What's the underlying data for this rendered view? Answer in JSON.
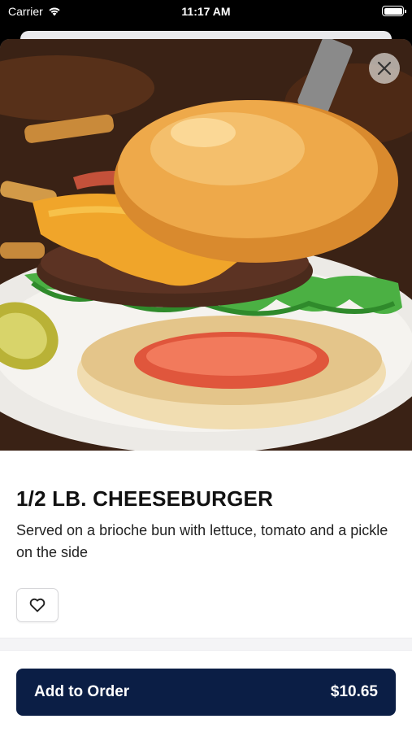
{
  "status_bar": {
    "carrier": "Carrier",
    "time": "11:17 AM"
  },
  "item": {
    "image": "cheeseburger-photo",
    "title": "1/2 LB. CHEESEBURGER",
    "description": "Served on a brioche bun with lettuce, tomato and a pickle on the side"
  },
  "actions": {
    "close_icon": "close-icon",
    "favorite_icon": "heart-icon"
  },
  "order": {
    "label": "Add to Order",
    "price": "$10.65"
  },
  "colors": {
    "primary": "#0b1e45",
    "background": "#ffffff",
    "divider": "#f4f4f6"
  }
}
